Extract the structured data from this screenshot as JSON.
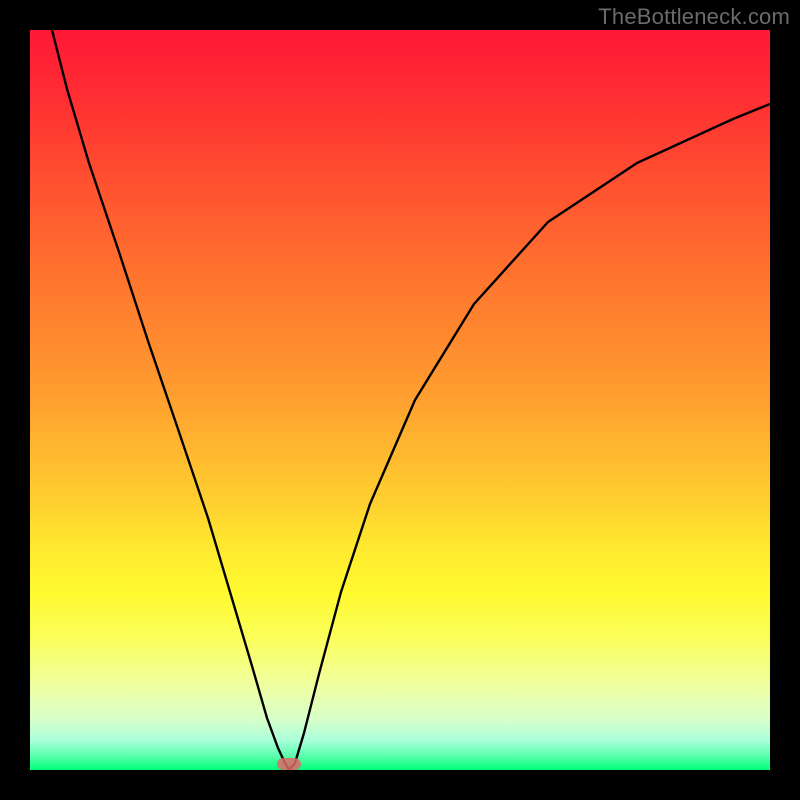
{
  "watermark": "TheBottleneck.com",
  "chart_data": {
    "type": "line",
    "title": "",
    "xlabel": "",
    "ylabel": "",
    "xlim": [
      0,
      100
    ],
    "ylim": [
      0,
      100
    ],
    "grid": false,
    "background": "rainbow-gradient-vertical",
    "series": [
      {
        "name": "bottleneck-curve",
        "x": [
          3,
          5,
          8,
          12,
          16,
          20,
          24,
          27,
          30,
          32,
          33.5,
          34.5,
          35,
          35.8,
          37,
          39,
          42,
          46,
          52,
          60,
          70,
          82,
          95,
          100
        ],
        "y": [
          100,
          92,
          82,
          70,
          58,
          46,
          34,
          24,
          14,
          7,
          3,
          1,
          0,
          1,
          5,
          13,
          24,
          36,
          50,
          63,
          74,
          82,
          88,
          90
        ]
      }
    ],
    "marker": {
      "x": 35,
      "y": 0,
      "color": "#e06868"
    },
    "axes_visible": false,
    "description": "V-shaped black curve over vertical green-to-red gradient; minimum sits on bottom green band around x≈35 with a small pink-red marker at the trough."
  }
}
